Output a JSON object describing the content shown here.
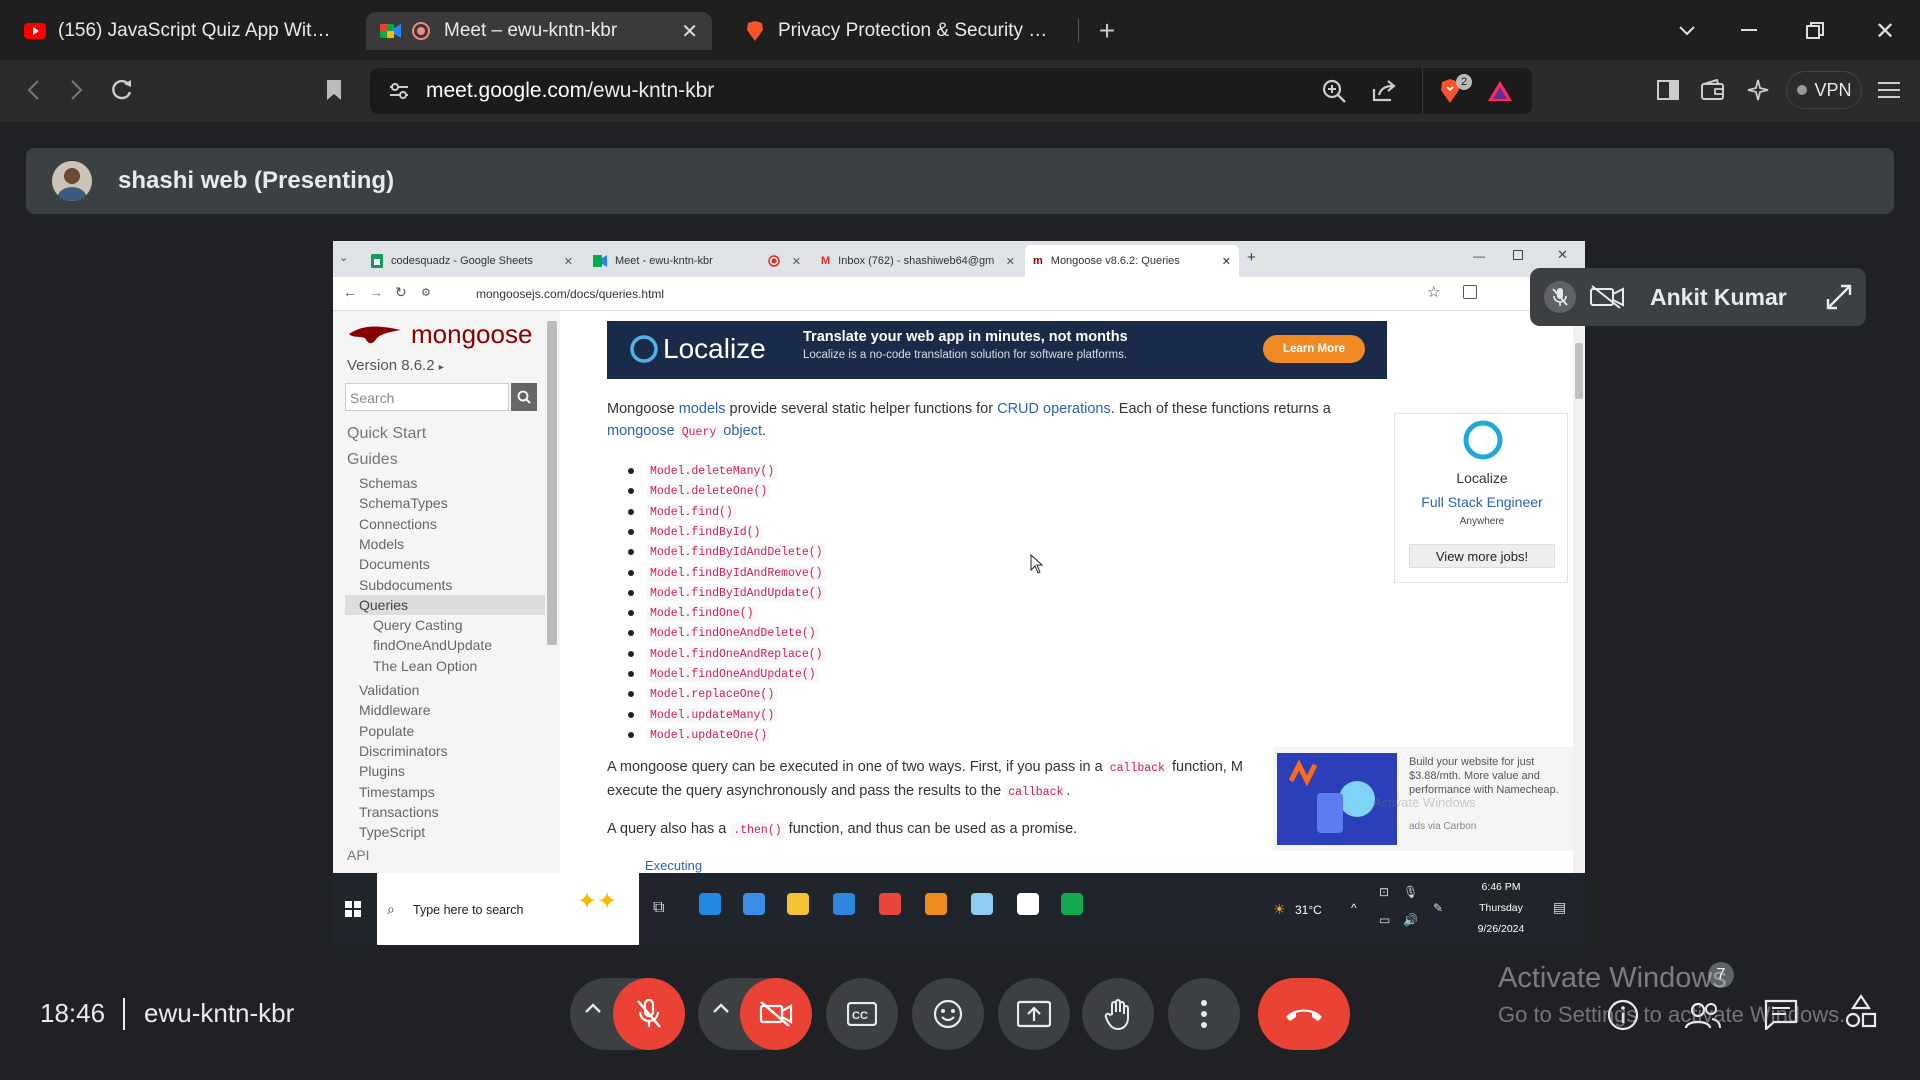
{
  "browser": {
    "tabs": [
      {
        "title": "(156) JavaScript Quiz App With Tim",
        "icon": "youtube-icon"
      },
      {
        "title": "Meet – ewu-kntn-kbr",
        "icon": "meet-icon",
        "active": true
      },
      {
        "title": "Privacy Protection & Security Featur",
        "icon": "brave-icon"
      }
    ],
    "url_host": "meet.google.com",
    "url_path": "/ewu-kntn-kbr",
    "vpn_label": "VPN",
    "brave_badge": "2"
  },
  "meet": {
    "presenter_label": "shashi web (Presenting)",
    "participant_name": "Ankit Kumar",
    "time": "18:46",
    "meeting_code": "ewu-kntn-kbr",
    "participants_count": "7",
    "watermark_title": "Activate Windows",
    "watermark_subtitle": "Go to Settings to activate Windows."
  },
  "shared": {
    "tabs": [
      {
        "title": "codesquadz - Google Sheets"
      },
      {
        "title": "Meet - ewu-kntn-kbr"
      },
      {
        "title": "Inbox (762) - shashiweb64@gm"
      },
      {
        "title": "Mongoose v8.6.2: Queries",
        "active": true
      }
    ],
    "url": "mongoosejs.com/docs/queries.html",
    "logo_text": "mongoose",
    "version": "Version 8.6.2",
    "search_placeholder": "Search",
    "nav": {
      "quick_start": "Quick Start",
      "guides": "Guides",
      "items": [
        "Schemas",
        "SchemaTypes",
        "Connections",
        "Models",
        "Documents",
        "Subdocuments",
        "Queries"
      ],
      "query_subitems": [
        "Query Casting",
        "findOneAndUpdate",
        "The Lean Option"
      ],
      "more_items": [
        "Validation",
        "Middleware",
        "Populate",
        "Discriminators",
        "Plugins",
        "Timestamps",
        "Transactions",
        "TypeScript"
      ],
      "api": "API"
    },
    "banner": {
      "brand": "Localize",
      "headline": "Translate your web app in minutes, not months",
      "subline": "Localize is a no-code translation solution for software platforms.",
      "cta": "Learn More"
    },
    "intro": {
      "part1": "Mongoose ",
      "models_link": "models",
      "part2": " provide several static helper functions for ",
      "crud_link": "CRUD operations",
      "part3": ". Each of these functions returns a",
      "mongoose_link": "mongoose",
      "query_code": "Query",
      "object_link": "object",
      "period": "."
    },
    "methods": [
      "Model.deleteMany()",
      "Model.deleteOne()",
      "Model.find()",
      "Model.findById()",
      "Model.findByIdAndDelete()",
      "Model.findByIdAndRemove()",
      "Model.findByIdAndUpdate()",
      "Model.findOne()",
      "Model.findOneAndDelete()",
      "Model.findOneAndReplace()",
      "Model.findOneAndUpdate()",
      "Model.replaceOne()",
      "Model.updateMany()",
      "Model.updateOne()"
    ],
    "para2": {
      "a": "A mongoose query can be executed in one of two ways. First, if you pass in a ",
      "code": "callback",
      "b": " function, M",
      "c": "execute the query asynchronously and pass the results to the ",
      "code2": "callback",
      "d": "."
    },
    "para3": {
      "a": "A query also has a ",
      "code": ".then()",
      "b": " function, and thus can be used as a promise."
    },
    "executing_link": "Executing",
    "job": {
      "company": "Localize",
      "title": "Full Stack Engineer",
      "location": "Anywhere",
      "button": "View more jobs!"
    },
    "ad": {
      "text": "Build your website for just $3.88/mth. More value and performance with Namecheap.",
      "via": "ads via Carbon",
      "watermark": "Activate Windows"
    },
    "taskbar": {
      "search_placeholder": "Type here to search",
      "temperature": "31°C",
      "clock_time": "6:46 PM",
      "clock_day": "Thursday",
      "clock_date": "9/26/2024"
    }
  },
  "colors": {
    "accent_red": "#ea4335",
    "mongoose_red": "#800",
    "link_blue": "#2a62b5"
  }
}
